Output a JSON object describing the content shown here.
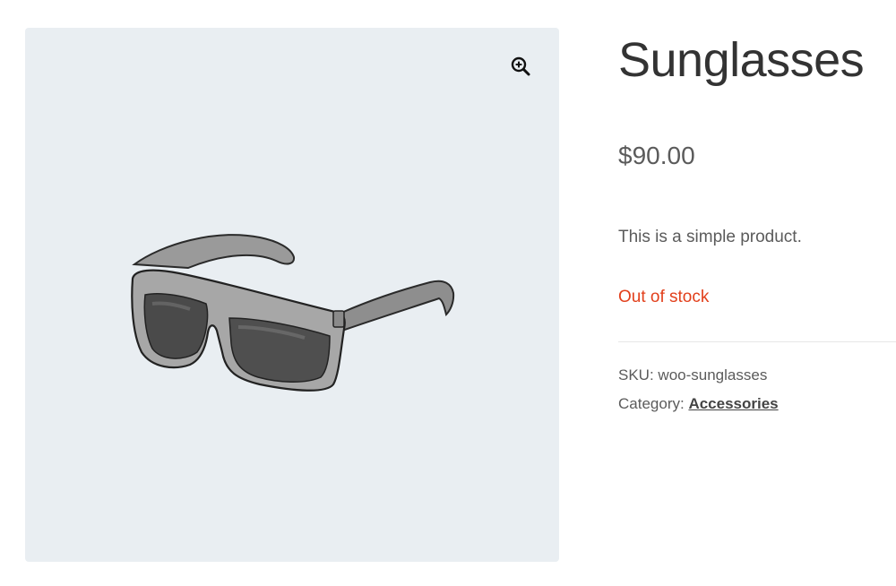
{
  "product": {
    "title": "Sunglasses",
    "price": "$90.00",
    "short_description": "This is a simple product.",
    "stock_status": "Out of stock",
    "sku_label": "SKU:",
    "sku_value": "woo-sunglasses",
    "category_label": "Category:",
    "category_value": "Accessories"
  },
  "gallery": {
    "zoom_icon": "zoom-in-magnifier-icon",
    "image_alt": "Sunglasses"
  },
  "colors": {
    "gallery_background": "#e9eef2",
    "stock_out": "#e2401c",
    "text": "#5b5b5b",
    "title": "#333333"
  }
}
